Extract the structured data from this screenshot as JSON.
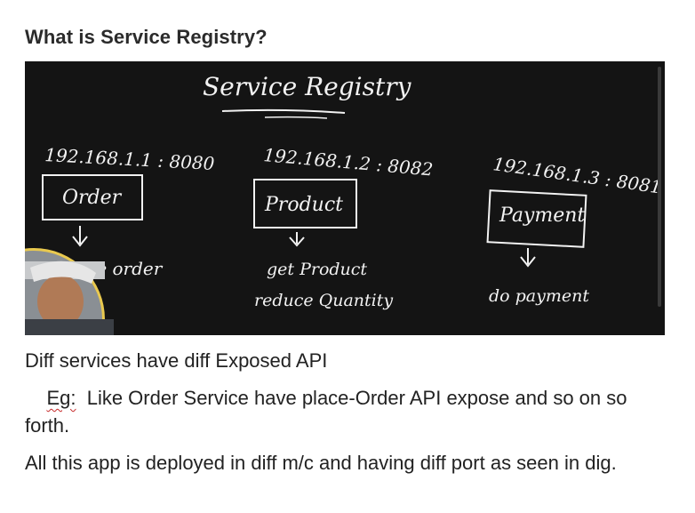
{
  "heading": "What is Service Registry?",
  "board": {
    "title": "Service Registry",
    "services": [
      {
        "address": "192.168.1.1 : 8080",
        "name": "Order",
        "apis": [
          "place order"
        ]
      },
      {
        "address": "192.168.1.2 : 8082",
        "name": "Product",
        "apis": [
          "get Product",
          "reduce Quantity"
        ]
      },
      {
        "address": "192.168.1.3 : 8081",
        "name": "Payment",
        "apis": [
          "do payment"
        ]
      }
    ]
  },
  "paragraphs": {
    "p1": "Diff services have diff Exposed API",
    "p2_indent": "    ",
    "p2_eg": "Eg:",
    "p2_rest": "  Like Order Service have place-Order API expose and so on so forth.",
    "p3": "All this app is deployed in diff m/c and having diff port as seen in dig."
  }
}
